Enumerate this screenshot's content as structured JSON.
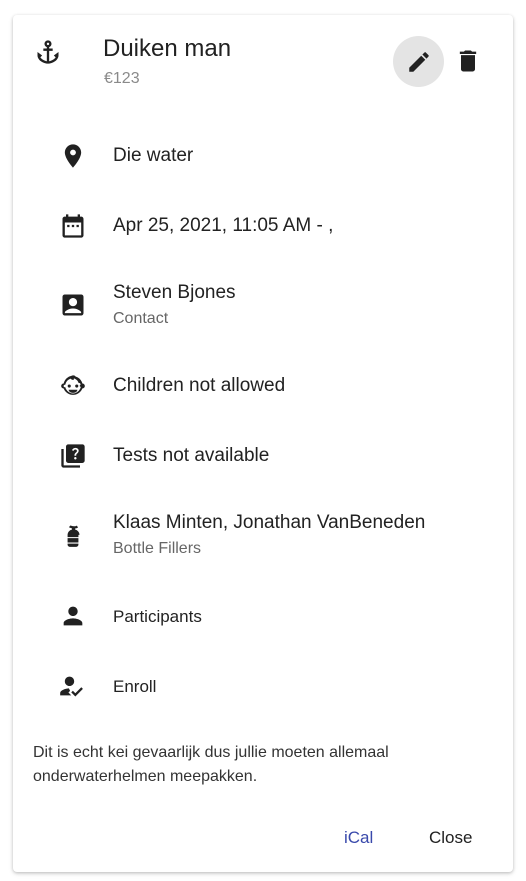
{
  "event": {
    "title": "Duiken man",
    "price": "€123"
  },
  "details": {
    "location": "Die water",
    "datetime": "Apr 25, 2021, 11:05 AM - ,",
    "contact_name": "Steven Bjones",
    "contact_label": "Contact",
    "children": "Children not allowed",
    "tests": "Tests not available",
    "fillers_names": "Klaas Minten, Jonathan VanBeneden",
    "fillers_label": "Bottle Fillers",
    "participants": "Participants",
    "enroll": "Enroll"
  },
  "description": "Dit is echt kei gevaarlijk dus jullie moeten allemaal onderwaterhelmen meepakken.",
  "actions": {
    "ical": "iCal",
    "close": "Close"
  },
  "colors": {
    "accent": "#3949ab",
    "icon": "#212121"
  },
  "icons": {
    "header": "anchor-icon",
    "edit": "pencil-icon",
    "delete": "trash-icon",
    "location": "map-pin-icon",
    "date": "calendar-icon",
    "contact": "contact-card-icon",
    "children": "baby-face-icon",
    "tests": "quiz-icon",
    "fillers": "fire-extinguisher-icon",
    "participants": "person-icon",
    "enroll": "person-check-icon"
  }
}
